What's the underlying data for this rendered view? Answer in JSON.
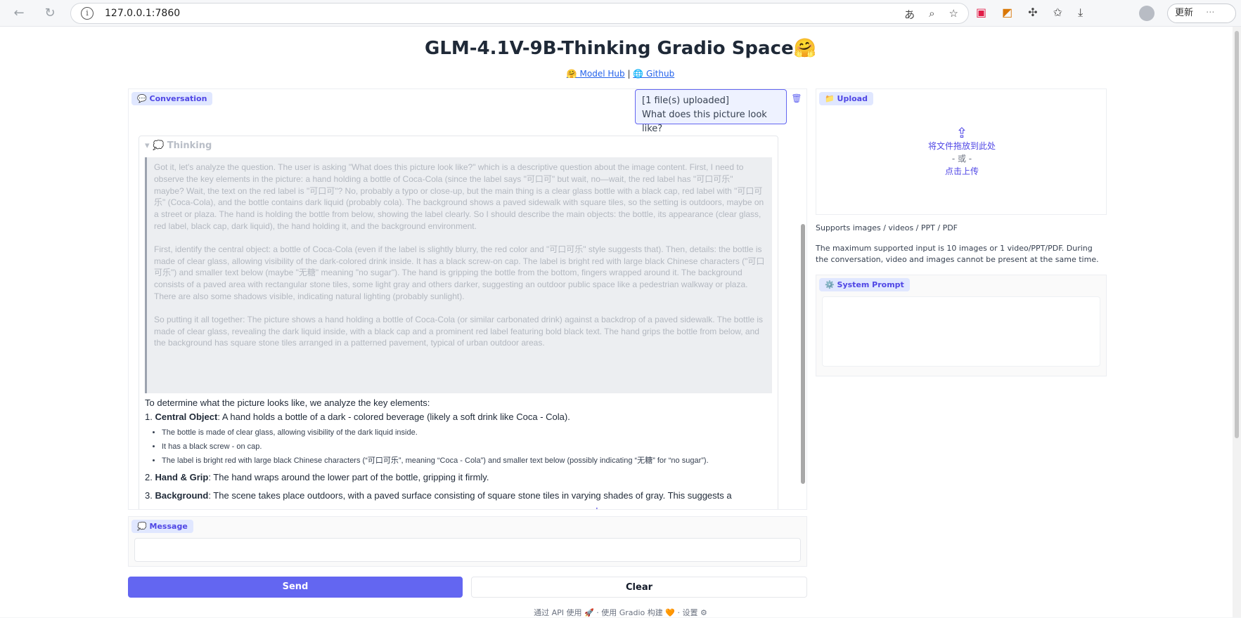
{
  "browser": {
    "url": "127.0.0.1:7860",
    "update_label": "更新"
  },
  "header": {
    "title": "GLM-4.1V-9B-Thinking Gradio Space🤗",
    "link1": "🤗 Model Hub",
    "separator": " | ",
    "link2": "🌐 Github"
  },
  "chat": {
    "label": "💬 Conversation",
    "user_message_line1": "[1 file(s) uploaded]",
    "user_message_line2": "What does this picture look like?",
    "thinking_label": "💭 Thinking",
    "thinking_paragraphs": [
      "Got it, let's analyze the question. The user is asking \"What does this picture look like?\" which is a descriptive question about the image content. First, I need to observe the key elements in the picture: a hand holding a bottle of Coca-Cola (since the label says \"可口可\" but wait, no—wait, the red label has \"可口可乐\" maybe? Wait, the text on the red label is \"可口可\"? No, probably a typo or close-up, but the main thing is a clear glass bottle with a black cap, red label with \"可口可乐\" (Coca-Cola), and the bottle contains dark liquid (probably cola). The background shows a paved sidewalk with square tiles, so the setting is outdoors, maybe on a street or plaza. The hand is holding the bottle from below, showing the label clearly. So I should describe the main objects: the bottle, its appearance (clear glass, red label, black cap, dark liquid), the hand holding it, and the background environment.",
      "First, identify the central object: a bottle of Coca-Cola (even if the label is slightly blurry, the red color and \"可口可乐\" style suggests that). Then, details: the bottle is made of clear glass, allowing visibility of the dark-colored drink inside. It has a black screw-on cap. The label is bright red with large black Chinese characters (\"可口可乐\") and smaller text below (maybe \"无糖\" meaning \"no sugar\"). The hand is gripping the bottle from the bottom, fingers wrapped around it. The background consists of a paved area with rectangular stone tiles, some light gray and others darker, suggesting an outdoor public space like a pedestrian walkway or plaza. There are also some shadows visible, indicating natural lighting (probably sunlight).",
      "So putting it all together: The picture shows a hand holding a bottle of Coca-Cola (or similar carbonated drink) against a backdrop of a paved sidewalk. The bottle is made of clear glass, revealing the dark liquid inside, with a black cap and a prominent red label featuring bold black text. The hand grips the bottle from below, and the background has square stone tiles arranged in a patterned pavement, typical of urban outdoor areas."
    ],
    "answer_intro": "To determine what the picture looks like, we analyze the key elements:",
    "items": [
      {
        "num": "1. ",
        "title": "Central Object",
        "text": ": A hand holds a bottle of a dark - colored beverage (likely a soft drink like Coca - Cola).",
        "bullets": [
          "The bottle is made of clear glass, allowing visibility of the dark liquid inside.",
          "It has a black screw - on cap.",
          "The label is bright red with large black Chinese characters (“可口可乐”, meaning “Coca - Cola”) and smaller text below (possibly indicating “无糖” for “no sugar”)."
        ]
      },
      {
        "num": "2. ",
        "title": "Hand & Grip",
        "text": ": The hand wraps around the lower part of the bottle, gripping it firmly."
      },
      {
        "num": "3. ",
        "title": "Background",
        "text": ": The scene takes place outdoors, with a paved surface consisting of square stone tiles in varying shades of gray. This suggests a"
      }
    ]
  },
  "message": {
    "label": "💭 Message",
    "value": ""
  },
  "buttons": {
    "send": "Send",
    "clear": "Clear"
  },
  "upload": {
    "label": "📁 Upload",
    "drop_text": "将文件拖放到此处",
    "or_text": "- 或 -",
    "click_text": "点击上传"
  },
  "notes": {
    "supports": "Supports images / videos / PPT / PDF",
    "limits": "The maximum supported input is 10 images or 1 video/PPT/PDF. During the conversation, video and images cannot be present at the same time."
  },
  "system_prompt": {
    "label": "⚙️ System Prompt",
    "value": ""
  },
  "footer": {
    "text": "通过 API 使用 🚀 · 使用 Gradio 构建 🧡 · 设置 ⚙"
  }
}
